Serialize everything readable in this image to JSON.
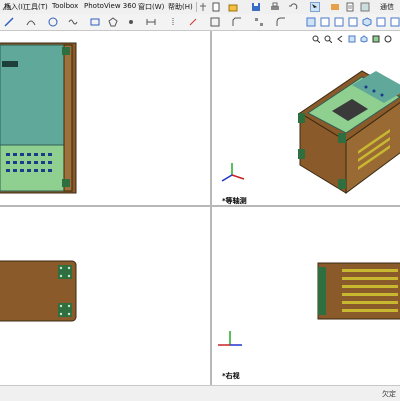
{
  "menu": {
    "items": [
      {
        "label": "插入(I)"
      },
      {
        "label": "工具(T)"
      },
      {
        "label": "Toolbox"
      },
      {
        "label": "PhotoView 360"
      },
      {
        "label": "窗口(W)"
      },
      {
        "label": "帮助(H)"
      },
      {
        "label": "通信"
      }
    ]
  },
  "viewports": {
    "top_right_label": "*等轴测",
    "bottom_right_label": "*右视"
  },
  "status": {
    "text": "欠定"
  },
  "colors": {
    "panel_teal": "#5fa89a",
    "panel_green": "#8fcf8f",
    "body_brown": "#8a5a2a",
    "vent_yellow": "#c8b830",
    "triad_x": "#cc2222",
    "triad_y": "#22aa22",
    "triad_z": "#2233cc"
  }
}
